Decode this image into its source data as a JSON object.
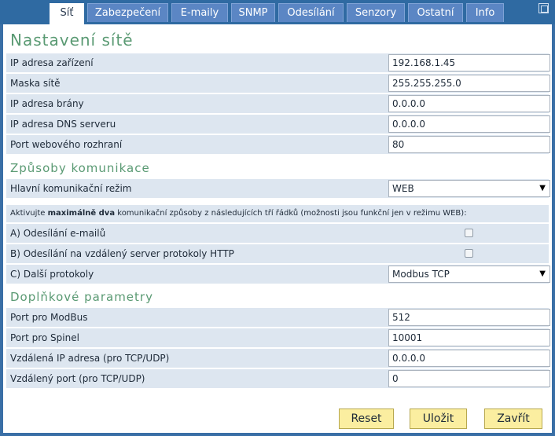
{
  "tabs": [
    {
      "label": "Síť",
      "active": true
    },
    {
      "label": "Zabezpečení"
    },
    {
      "label": "E-maily"
    },
    {
      "label": "SNMP"
    },
    {
      "label": "Odesílání"
    },
    {
      "label": "Senzory"
    },
    {
      "label": "Ostatní"
    },
    {
      "label": "Info"
    }
  ],
  "network": {
    "title": "Nastavení sítě",
    "ip_label": "IP adresa zařízení",
    "ip_value": "192.168.1.45",
    "mask_label": "Maska sítě",
    "mask_value": "255.255.255.0",
    "gateway_label": "IP adresa brány",
    "gateway_value": "0.0.0.0",
    "dns_label": "IP adresa DNS serveru",
    "dns_value": "0.0.0.0",
    "port_label": "Port webového rozhraní",
    "port_value": "80"
  },
  "communication": {
    "title": "Způsoby komunikace",
    "mode_label": "Hlavní komunikační režim",
    "mode_value": "WEB",
    "note_pre": "Aktivujte ",
    "note_bold": "maximálně dva",
    "note_post": " komunikační způsoby z následujících tří řádků (možnosti jsou funkční jen v režimu WEB):",
    "email_label": "A) Odesílání e-mailů",
    "email_checked": false,
    "http_label": "B) Odesílání na vzdálený server protokoly HTTP",
    "http_checked": false,
    "other_label": "C) Další protokoly",
    "other_value": "Modbus TCP"
  },
  "extra": {
    "title": "Doplňkové parametry",
    "modbus_label": "Port pro ModBus",
    "modbus_value": "512",
    "spinel_label": "Port pro Spinel",
    "spinel_value": "10001",
    "remote_ip_label": "Vzdálená IP adresa (pro TCP/UDP)",
    "remote_ip_value": "0.0.0.0",
    "remote_port_label": "Vzdálený port (pro TCP/UDP)",
    "remote_port_value": "0"
  },
  "buttons": {
    "reset": "Reset",
    "save": "Uložit",
    "close": "Zavřít"
  },
  "colors": {
    "accent_heading": "#5a9a73",
    "tab_bg": "#5b86c4",
    "row_bg": "#dde6f0",
    "button_bg": "#fbeea0"
  }
}
